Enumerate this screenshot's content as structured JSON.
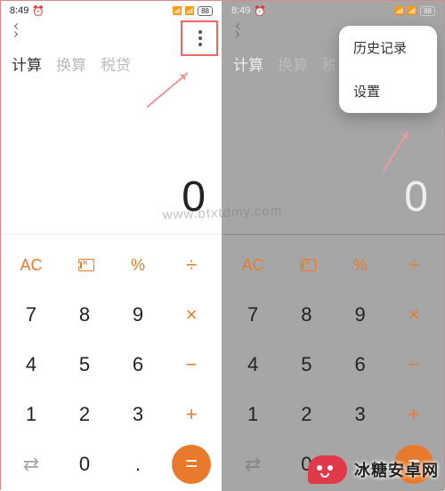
{
  "status": {
    "time": "8:49",
    "alarm_icon": "alarm-icon",
    "signal": "ill ill",
    "wifi": "wifi-icon",
    "battery": "88"
  },
  "tabs": {
    "calc": "计算",
    "convert": "换算",
    "tax": "税贷"
  },
  "display": {
    "value": "0"
  },
  "keys": {
    "ac": "AC",
    "backspace": "⌫",
    "percent": "%",
    "divide": "÷",
    "k7": "7",
    "k8": "8",
    "k9": "9",
    "mult": "×",
    "k4": "4",
    "k5": "5",
    "k6": "6",
    "minus": "−",
    "k1": "1",
    "k2": "2",
    "k3": "3",
    "plus": "+",
    "switch": "⇄",
    "k0": "0",
    "dot": ".",
    "equals": "="
  },
  "menu": {
    "history": "历史记录",
    "settings": "设置"
  },
  "watermark": {
    "text": "冰糖安卓网",
    "url": "www.btxtdmy.com"
  },
  "colors": {
    "accent": "#e87a2d",
    "highlight": "#e66"
  }
}
